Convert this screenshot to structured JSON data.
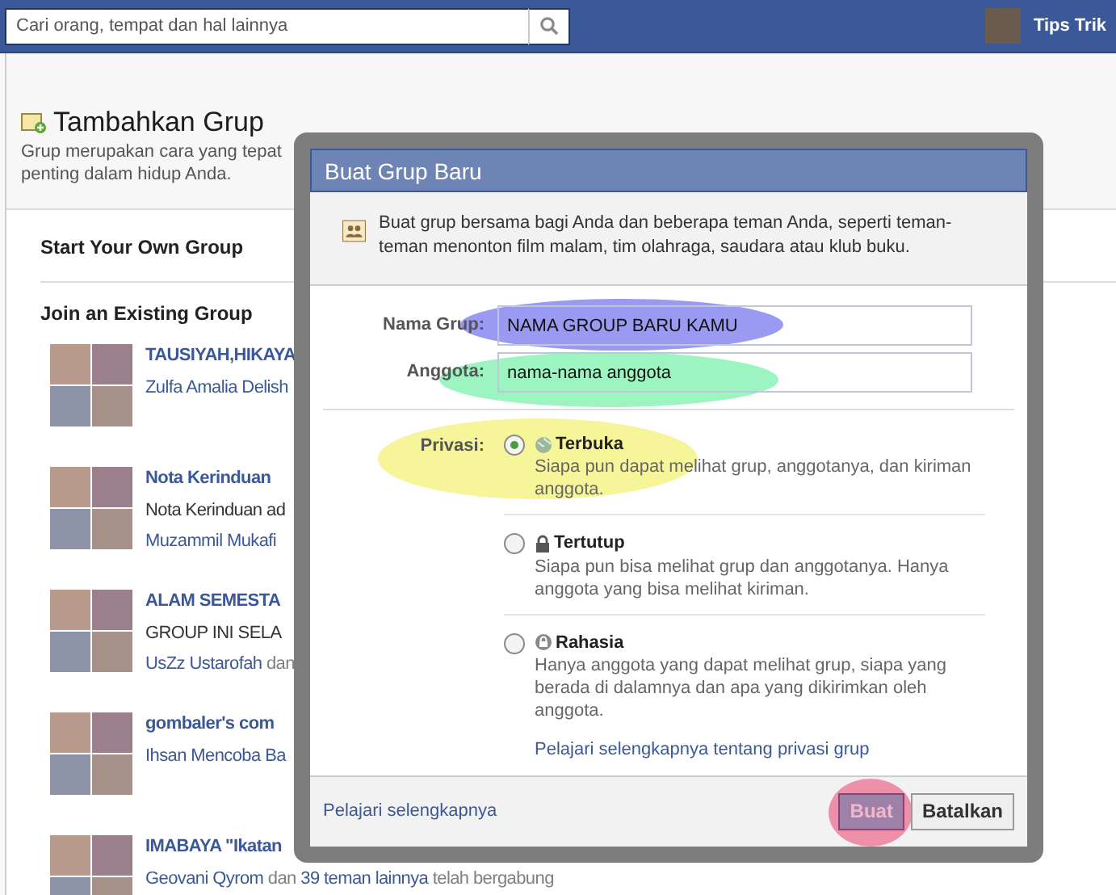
{
  "top_bar": {
    "search": {
      "placeholder": "Cari orang, tempat dan hal lainnya"
    },
    "user": {
      "name": "Tips Trik"
    }
  },
  "page": {
    "title": "Tambahkan Grup",
    "intro": [
      "Grup merupakan cara yang tepat",
      "penting dalam hidup Anda."
    ],
    "sections": [
      "Start Your Own Group",
      "Join an Existing Group"
    ],
    "groups": [
      {
        "name": "TAUSIYAH,HIKAYA",
        "members": [
          {
            "kind": "link",
            "text": "Zulfa Amalia Delish"
          }
        ]
      },
      {
        "name": "Nota Kerinduan",
        "description": "Nota Kerinduan ad",
        "members": [
          {
            "kind": "link",
            "text": "Muzammil Mukafi"
          }
        ]
      },
      {
        "name": "ALAM SEMESTA",
        "description": "GROUP INI SELA",
        "members": [
          {
            "kind": "link",
            "text": "UsZz Ustarofah"
          },
          {
            "kind": "plain",
            "text": "dan"
          }
        ]
      },
      {
        "name": "gombaler's com",
        "members": [
          {
            "kind": "link",
            "text": "Ihsan Mencoba Ba"
          }
        ]
      },
      {
        "name": "IMABAYA \"Ikatan",
        "members": [
          {
            "kind": "link",
            "text": "Geovani Qyrom"
          },
          {
            "kind": "plain",
            "text": "dan"
          },
          {
            "kind": "link",
            "text": "39 teman lainnya"
          },
          {
            "kind": "plain",
            "text": "telah bergabung"
          }
        ]
      }
    ]
  },
  "dialog": {
    "title": "Buat Grup Baru",
    "info": "Buat grup bersama bagi Anda dan beberapa teman Anda, seperti teman-teman menonton film malam, tim olahraga, saudara atau klub buku.",
    "fields": [
      {
        "label": "Nama Grup:",
        "value": "NAMA GROUP BARU KAMU",
        "color": "#9a9af2"
      },
      {
        "label": "Anggota:",
        "value": "nama-nama anggota",
        "color": "#9cf5c0"
      }
    ],
    "privacy": {
      "label": "Privasi:",
      "color": "#f6f59a",
      "options": [
        {
          "title": "Terbuka",
          "description": "Siapa pun dapat melihat grup, anggotanya, dan kiriman anggota.",
          "selected": true
        },
        {
          "title": "Tertutup",
          "description": "Siapa pun bisa melihat grup dan anggotanya. Hanya anggota yang bisa melihat kiriman.",
          "selected": false
        },
        {
          "title": "Rahasia",
          "description": "Hanya anggota yang dapat melihat grup, siapa yang berada di dalamnya dan apa yang dikirimkan oleh anggota.",
          "selected": false
        }
      ],
      "link": "Pelajari selengkapnya tentang privasi grup"
    },
    "footer_link": "Pelajari selengkapnya",
    "buttons": [
      {
        "label": "Buat",
        "kind": "primary",
        "color": "#ee90aa"
      },
      {
        "label": "Batalkan",
        "kind": "secondary"
      }
    ]
  }
}
